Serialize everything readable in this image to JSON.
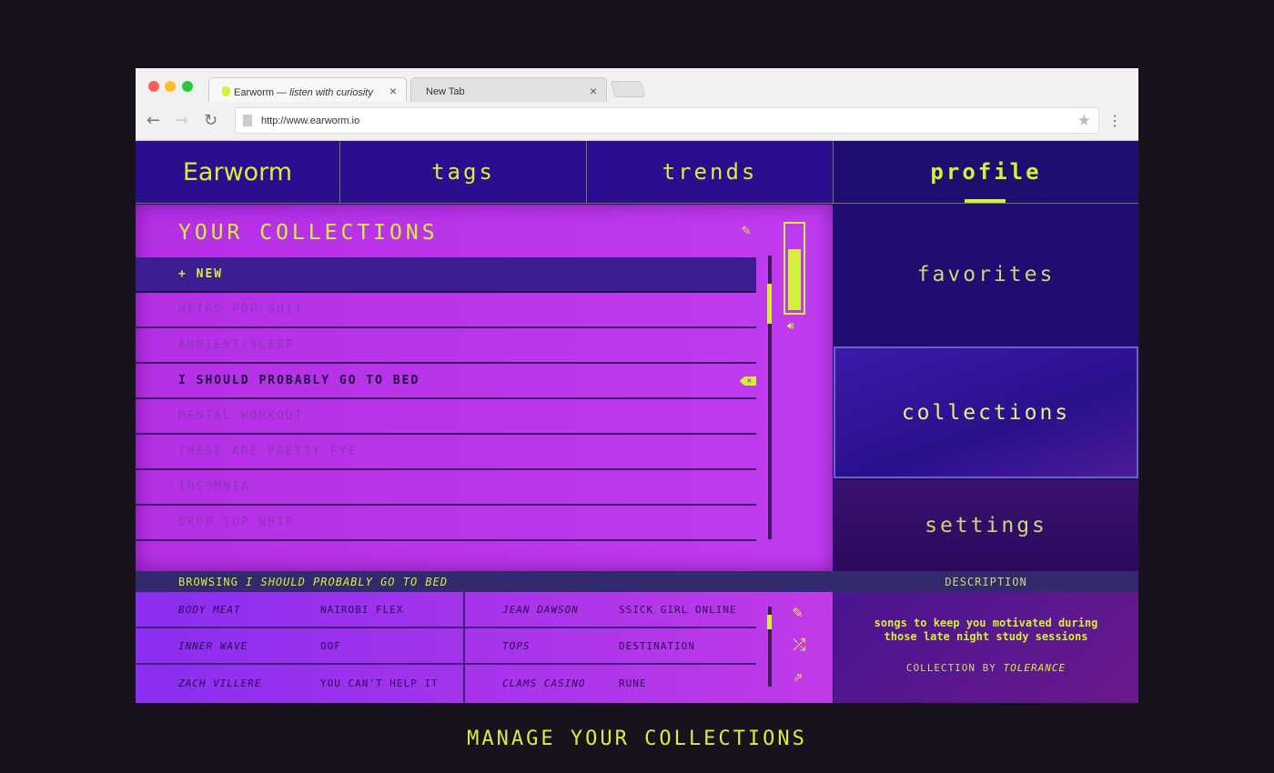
{
  "browser": {
    "tabs": [
      {
        "title": "Earworm — ",
        "subtitle": "listen with curiosity"
      },
      {
        "title": "New Tab"
      }
    ],
    "url": "http://www.earworm.io"
  },
  "nav": {
    "logo": "Earworm",
    "items": [
      "tags",
      "trends",
      "profile"
    ],
    "active": "profile"
  },
  "collections": {
    "title": "YOUR COLLECTIONS",
    "new_label": "+ NEW",
    "items": [
      "WEIRD POP SHIT",
      "AMBIENT/SLEEP",
      "I SHOULD PROBABLY GO TO BED",
      "MENTAL WORKOUT",
      "THESE ARE PRETTY FYE",
      "INSOMNIA",
      "DROP TOP WHIP"
    ],
    "selected": "I SHOULD PROBABLY GO TO BED",
    "volume_percent": 75
  },
  "side": {
    "items": [
      "favorites",
      "collections",
      "settings"
    ],
    "active": "collections"
  },
  "browsing": {
    "label": "BROWSING",
    "collection": "I SHOULD PROBABLY GO TO BED",
    "description_label": "DESCRIPTION"
  },
  "tracks": [
    {
      "artist": "BODY MEAT",
      "title": "NAIROBI FLEX"
    },
    {
      "artist": "INNER WAVE",
      "title": "OOF"
    },
    {
      "artist": "ZACH VILLERE",
      "title": "YOU CAN'T HELP IT"
    },
    {
      "artist": "JEAN DAWSON",
      "title": "SSICK GIRL ONLINE"
    },
    {
      "artist": "TOPS",
      "title": "DESTINATION"
    },
    {
      "artist": "CLAMS CASINO",
      "title": "RUNE"
    }
  ],
  "description": {
    "text": "songs to keep you motivated during those late night study sessions",
    "by_label": "COLLECTION BY",
    "author": "TOLERANCE"
  },
  "caption": "MANAGE YOUR COLLECTIONS",
  "colors": {
    "accent": "#d4f03a",
    "panel": "#b52fe6",
    "nav": "#2b0e8e"
  }
}
